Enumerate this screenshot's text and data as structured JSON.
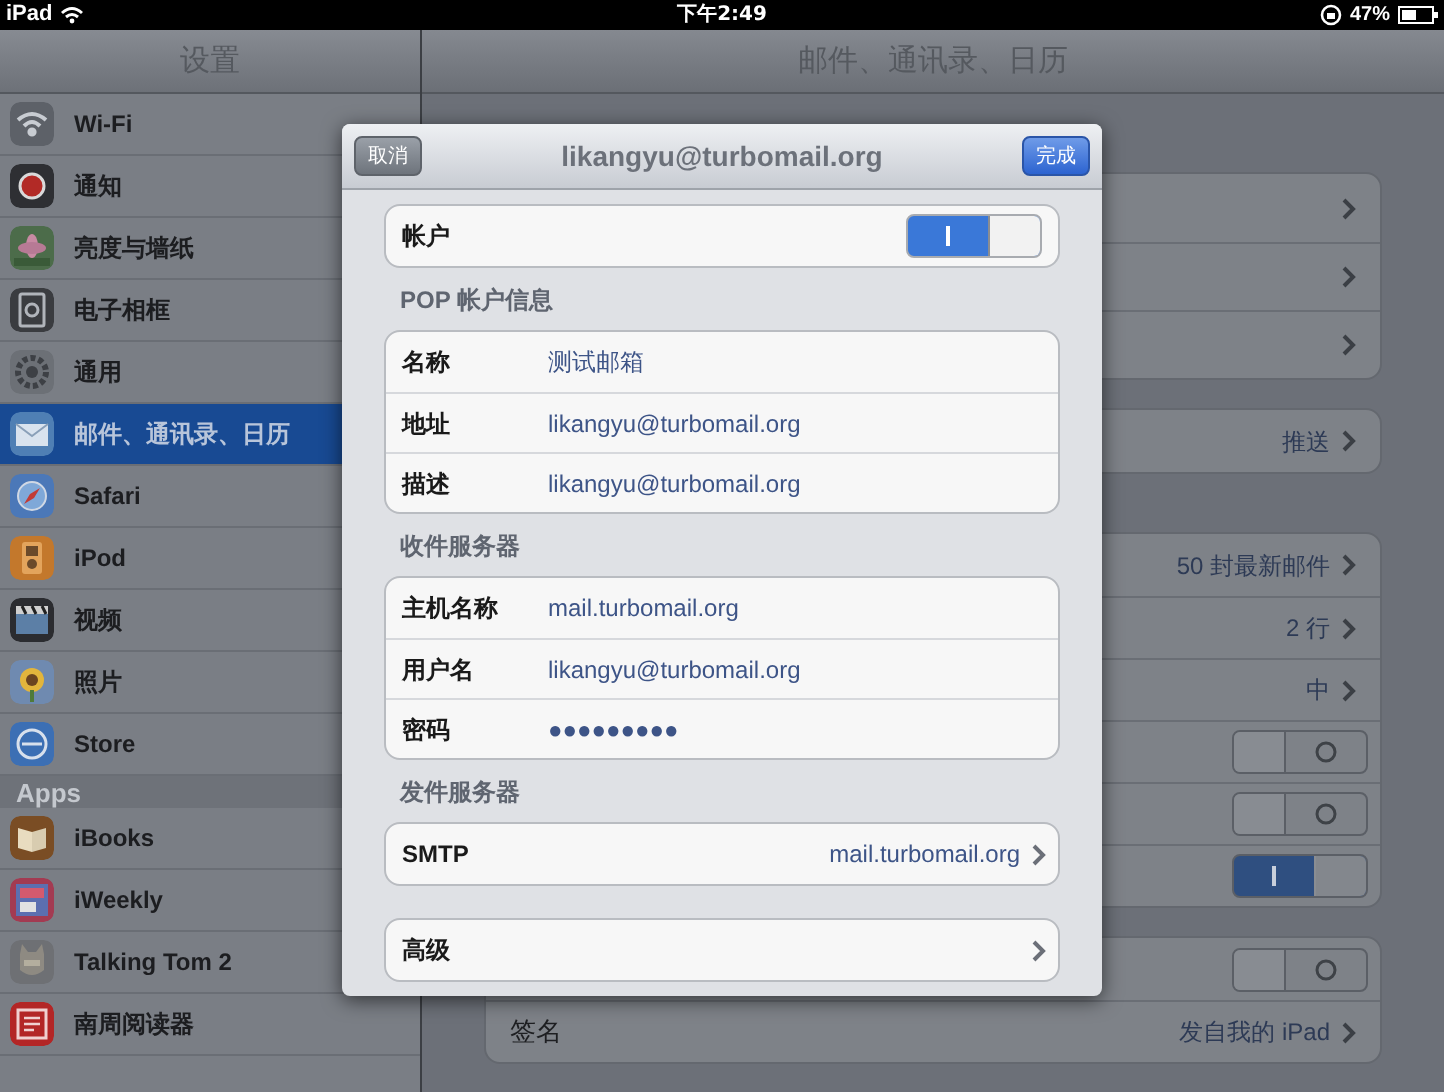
{
  "status_bar": {
    "device": "iPad",
    "time": "下午2:49",
    "battery": "47%"
  },
  "sidebar": {
    "title": "设置",
    "groups": [
      {
        "items": [
          {
            "label": "Wi-Fi",
            "selected": false
          },
          {
            "label": "通知",
            "selected": false
          },
          {
            "label": "亮度与墙纸",
            "selected": false
          },
          {
            "label": "电子相框",
            "selected": false
          },
          {
            "label": "通用",
            "selected": false
          },
          {
            "label": "邮件、通讯录、日历",
            "selected": true
          },
          {
            "label": "Safari",
            "selected": false
          },
          {
            "label": "iPod",
            "selected": false
          },
          {
            "label": "视频",
            "selected": false
          },
          {
            "label": "照片",
            "selected": false
          },
          {
            "label": "Store",
            "selected": false
          }
        ]
      },
      {
        "header": "Apps",
        "items": [
          {
            "label": "iBooks",
            "selected": false
          },
          {
            "label": "iWeekly",
            "selected": false
          },
          {
            "label": "Talking Tom 2",
            "selected": false
          },
          {
            "label": "南周阅读器",
            "selected": false
          }
        ]
      }
    ]
  },
  "detail": {
    "title": "邮件、通讯录、日历",
    "groups": [
      {
        "rows": [
          {
            "kind": "link"
          },
          {
            "kind": "link"
          },
          {
            "kind": "link"
          }
        ]
      },
      {
        "rows": [
          {
            "kind": "link",
            "value": "推送"
          }
        ]
      },
      {
        "rows": [
          {
            "kind": "link",
            "value": "50 封最新邮件"
          },
          {
            "kind": "link",
            "value": "2 行"
          },
          {
            "kind": "link",
            "value": "中"
          },
          {
            "kind": "toggle",
            "on": false
          },
          {
            "kind": "toggle",
            "on": false
          },
          {
            "kind": "toggle",
            "on": true
          }
        ]
      },
      {
        "rows": [
          {
            "kind": "toggle",
            "on": false
          },
          {
            "kind": "link",
            "label": "签名",
            "value": "发自我的 iPad"
          }
        ]
      }
    ]
  },
  "modal": {
    "title": "likangyu@turbomail.org",
    "cancel": "取消",
    "done": "完成",
    "sections": [
      {
        "rows": [
          {
            "kind": "toggle",
            "label": "帐户",
            "on": true
          }
        ]
      },
      {
        "header": "POP 帐户信息",
        "rows": [
          {
            "kind": "field",
            "label": "名称",
            "value": "测试邮箱"
          },
          {
            "kind": "field",
            "label": "地址",
            "value": "likangyu@turbomail.org"
          },
          {
            "kind": "field",
            "label": "描述",
            "value": "likangyu@turbomail.org"
          }
        ]
      },
      {
        "header": "收件服务器",
        "rows": [
          {
            "kind": "field",
            "label": "主机名称",
            "value": "mail.turbomail.org"
          },
          {
            "kind": "field",
            "label": "用户名",
            "value": "likangyu@turbomail.org"
          },
          {
            "kind": "field",
            "label": "密码",
            "value": "●●●●●●●●●"
          }
        ]
      },
      {
        "header": "发件服务器",
        "rows": [
          {
            "kind": "link",
            "label": "SMTP",
            "value": "mail.turbomail.org"
          }
        ]
      },
      {
        "rows": [
          {
            "kind": "link",
            "label": "高级"
          }
        ]
      }
    ]
  }
}
